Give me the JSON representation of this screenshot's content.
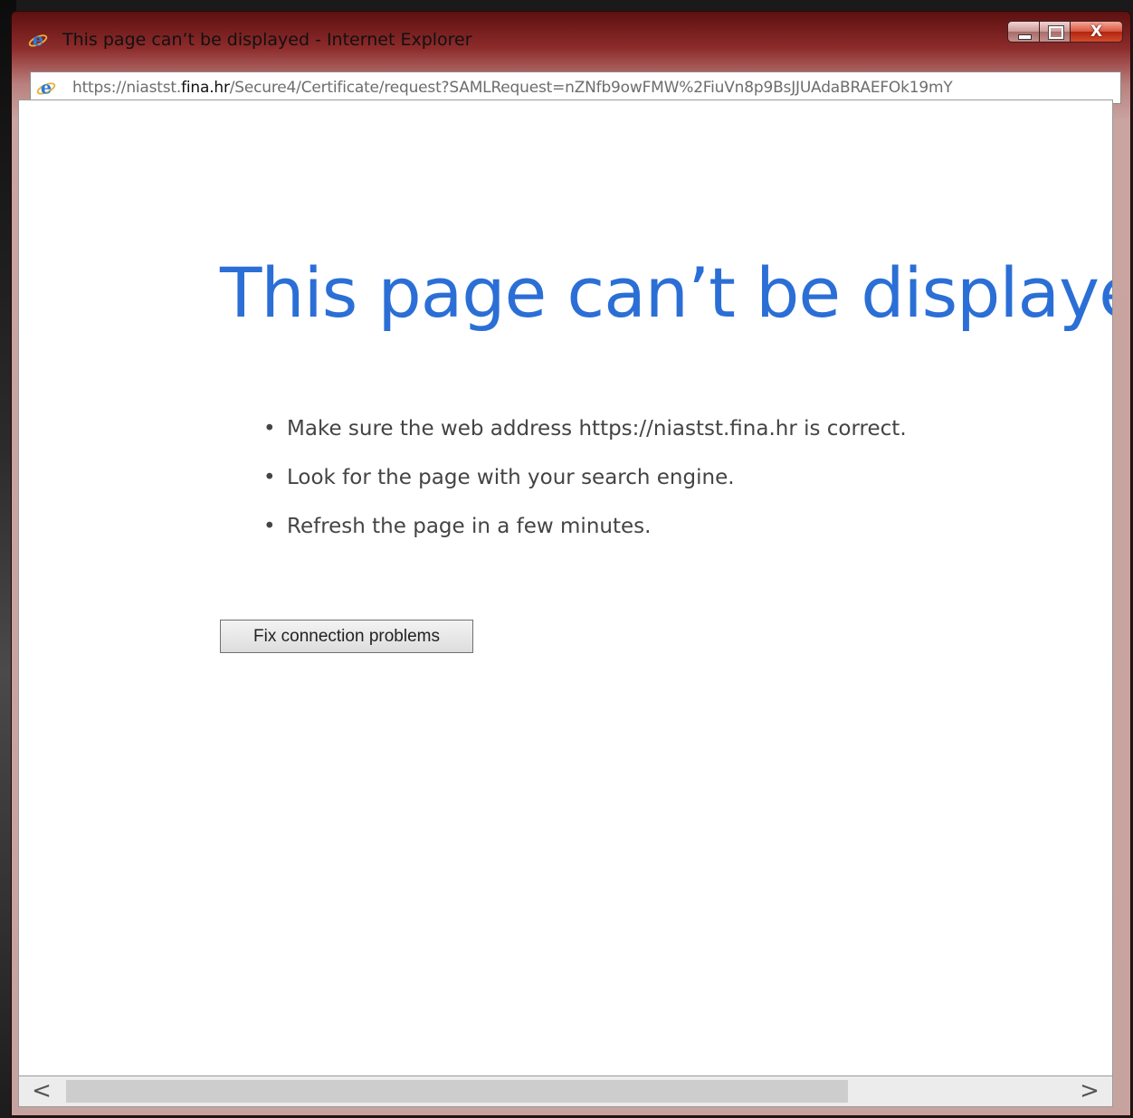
{
  "window": {
    "title": "This page can’t be displayed - Internet Explorer",
    "app_icon": "internet-explorer-icon",
    "controls": {
      "minimize_icon": "minimize-icon",
      "maximize_icon": "maximize-icon",
      "close_glyph": "X"
    }
  },
  "address_bar": {
    "url_prefix": "https://niastst.",
    "url_domain": "fina.hr",
    "url_path": "/Secure4/Certificate/request?SAMLRequest=nZNfb9owFMW%2FiuVn8p9BsJJUAdaBRAEFOk19mY"
  },
  "page": {
    "heading": "This page can’t be displayed",
    "suggestions": [
      "Make sure the web address https://niastst.fina.hr is correct.",
      "Look for the page with your search engine.",
      "Refresh the page in a few minutes."
    ],
    "fix_button_label": "Fix connection problems"
  },
  "scrollbar": {
    "left_glyph": "<",
    "right_glyph": ">"
  },
  "colors": {
    "heading": "#2b6fd6",
    "titlebar": "#8d2b2b",
    "close_button": "#d5553f"
  }
}
